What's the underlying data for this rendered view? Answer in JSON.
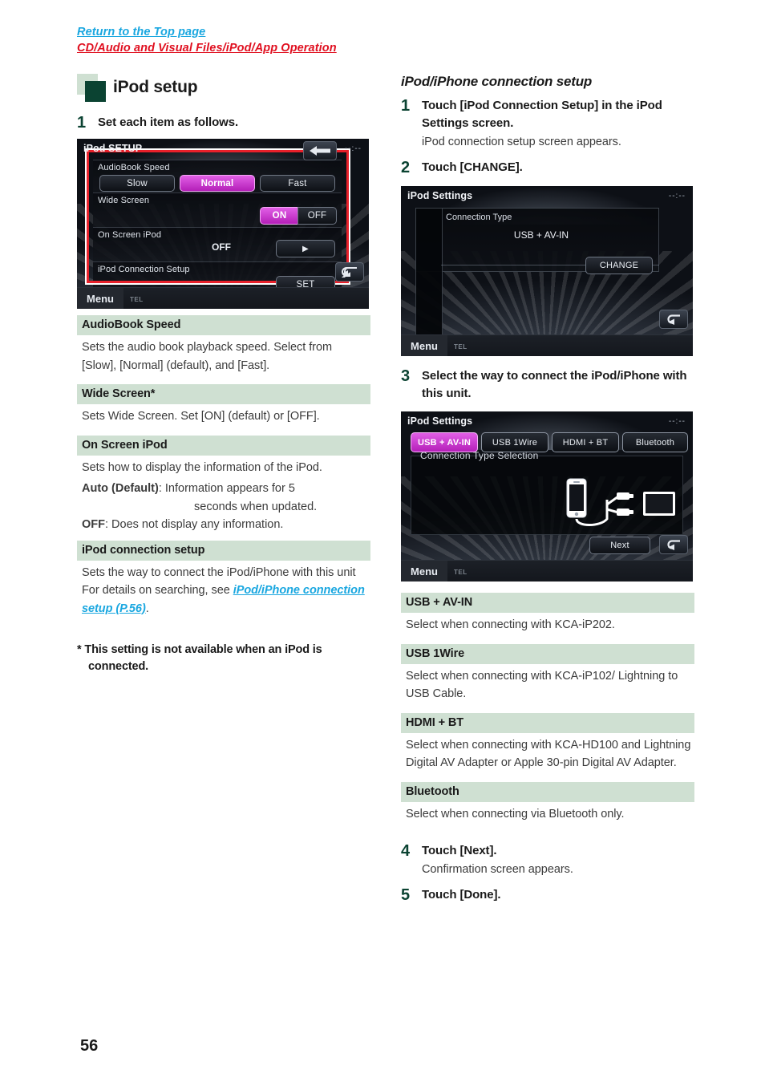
{
  "breadcrumb": {
    "top_link": "Return to the Top page",
    "sub_link": "CD/Audio and Visual Files/iPod/App Operation"
  },
  "page_number": "56",
  "left_column": {
    "heading": "iPod setup",
    "step1": {
      "num": "1",
      "title": "Set each item as follows."
    },
    "screenshot1": {
      "title": "iPod SETUP",
      "clock": "--:--",
      "menu_label": "Menu",
      "tel_label": "TEL",
      "rows": [
        {
          "label": "AudioBook Speed",
          "buttons": [
            "Slow",
            "Normal",
            "Fast"
          ],
          "selected": "Normal"
        },
        {
          "label": "Wide Screen",
          "buttons": [
            "ON",
            "OFF"
          ],
          "selected": "ON"
        },
        {
          "label": "On Screen iPod",
          "value": "OFF",
          "arrow": "▶"
        },
        {
          "label": "iPod Connection Setup",
          "buttons": [
            "SET"
          ],
          "selected": ""
        }
      ]
    },
    "definitions": [
      {
        "term": "AudioBook Speed",
        "body": "Sets the audio book playback speed. Select from [Slow], [Normal] (default), and [Fast]."
      },
      {
        "term": "Wide Screen*",
        "body": "Sets Wide Screen. Set [ON] (default) or [OFF]."
      },
      {
        "term": "On Screen iPod",
        "body": "Sets how to display the information of the iPod.",
        "auto_label": "Auto (Default)",
        "auto_text": ": Information appears for 5",
        "auto_text2": "seconds when updated.",
        "off_label": "OFF",
        "off_text": ": Does not display any information."
      },
      {
        "term": "iPod connection setup",
        "body_pre": "Sets the way to connect the iPod/iPhone with this unit  For details on searching, see ",
        "body_link": "iPod/iPhone connection setup (P.56)",
        "body_post": "."
      }
    ],
    "footnote": "* This setting is not available when an iPod is connected."
  },
  "right_column": {
    "sub_heading": "iPod/iPhone connection setup",
    "step1": {
      "num": "1",
      "title": "Touch [iPod Connection Setup] in the iPod Settings screen.",
      "note": "iPod connection setup screen appears."
    },
    "step2": {
      "num": "2",
      "title": "Touch [CHANGE]."
    },
    "screenshot2": {
      "title": "iPod Settings",
      "clock": "--:--",
      "connection_type_label": "Connection Type",
      "connection_type_value": "USB + AV-IN",
      "change_button": "CHANGE",
      "menu_label": "Menu",
      "tel_label": "TEL"
    },
    "step3": {
      "num": "3",
      "title": "Select the way to connect the iPod/iPhone with this unit."
    },
    "screenshot3": {
      "title": "iPod Settings",
      "clock": "--:--",
      "tabs": [
        "USB + AV-IN",
        "USB 1Wire",
        "HDMI + BT",
        "Bluetooth"
      ],
      "selected_tab": "USB + AV-IN",
      "panel_label": "Connection Type Selection",
      "next_button": "Next",
      "menu_label": "Menu",
      "tel_label": "TEL"
    },
    "definitions": [
      {
        "term": "USB + AV-IN",
        "body": "Select when connecting with KCA-iP202."
      },
      {
        "term": "USB 1Wire",
        "body": "Select when connecting with KCA-iP102/ Lightning to USB Cable."
      },
      {
        "term": "HDMI + BT",
        "body": "Select when connecting with KCA-HD100 and Lightning Digital AV Adapter or Apple 30-pin Digital AV Adapter."
      },
      {
        "term": "Bluetooth",
        "body": "Select when connecting via Bluetooth only."
      }
    ],
    "step4": {
      "num": "4",
      "title": "Touch [Next].",
      "note": "Confirmation screen appears."
    },
    "step5": {
      "num": "5",
      "title": "Touch [Done]."
    }
  },
  "colors": {
    "link_blue": "#1aa7e0",
    "link_red": "#e01020",
    "green_dark": "#0b4332",
    "green_light": "#cfe0d2",
    "highlight_magenta": "#c322c7",
    "redbox": "#e8202a"
  }
}
